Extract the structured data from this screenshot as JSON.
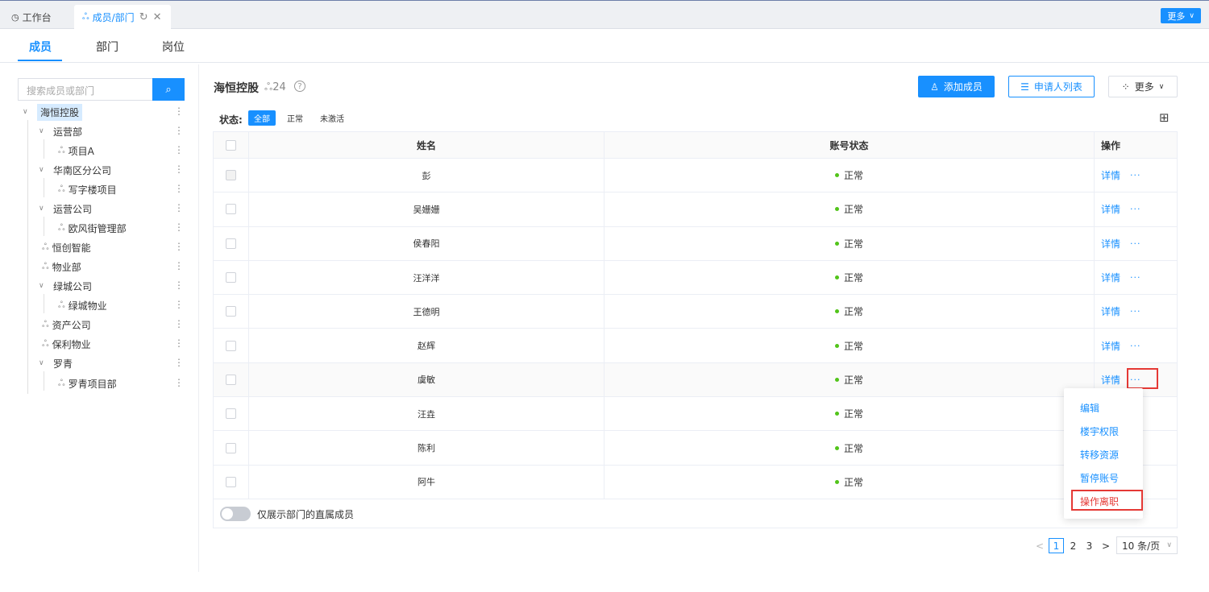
{
  "topbar": {
    "tabs": [
      {
        "label": "工作台",
        "icon": "dashboard-icon"
      },
      {
        "label": "成员/部门",
        "icon": "org-chart-icon"
      }
    ],
    "more_label": "更多"
  },
  "subnav": {
    "items": [
      "成员",
      "部门",
      "岗位"
    ],
    "active": "成员"
  },
  "sidebar": {
    "search_placeholder": "搜索成员或部门",
    "tree": [
      {
        "label": "海恒控股",
        "level": 0,
        "expandable": true,
        "selected": true
      },
      {
        "label": "运营部",
        "level": 1,
        "expandable": true
      },
      {
        "label": "项目A",
        "level": 2,
        "expandable": false
      },
      {
        "label": "华南区分公司",
        "level": 1,
        "expandable": true
      },
      {
        "label": "写字楼项目",
        "level": 2,
        "expandable": false
      },
      {
        "label": "运营公司",
        "level": 1,
        "expandable": true
      },
      {
        "label": "欧风街管理部",
        "level": 2,
        "expandable": false
      },
      {
        "label": "恒创智能",
        "level": 1,
        "expandable": false
      },
      {
        "label": "物业部",
        "level": 1,
        "expandable": false
      },
      {
        "label": "绿城公司",
        "level": 1,
        "expandable": true
      },
      {
        "label": "绿城物业",
        "level": 2,
        "expandable": false
      },
      {
        "label": "资产公司",
        "level": 1,
        "expandable": false
      },
      {
        "label": "保利物业",
        "level": 1,
        "expandable": false
      },
      {
        "label": "罗青",
        "level": 1,
        "expandable": true
      },
      {
        "label": "罗青项目部",
        "level": 2,
        "expandable": false
      }
    ]
  },
  "main": {
    "title": "海恒控股",
    "member_count": "24",
    "buttons": {
      "add": "添加成员",
      "applicants": "申请人列表",
      "more": "更多"
    },
    "status_label": "状态:",
    "filters": [
      "全部",
      "正常",
      "未激活"
    ],
    "columns": {
      "name": "姓名",
      "status": "账号状态",
      "ops": "操作"
    },
    "rows": [
      {
        "name": "彭",
        "status": "正常"
      },
      {
        "name": "吴姗姗",
        "status": "正常"
      },
      {
        "name": "侯春阳",
        "status": "正常"
      },
      {
        "name": "汪洋洋",
        "status": "正常"
      },
      {
        "name": "王德明",
        "status": "正常"
      },
      {
        "name": "赵辉",
        "status": "正常"
      },
      {
        "name": "虞敏",
        "status": "正常"
      },
      {
        "name": "汪垚",
        "status": "正常"
      },
      {
        "name": "陈利",
        "status": "正常"
      },
      {
        "name": "阿牛",
        "status": "正常"
      }
    ],
    "detail_label": "详情",
    "more_dots": "···",
    "toggle_label": "仅展示部门的直属成员"
  },
  "menu": {
    "items": [
      "编辑",
      "楼宇权限",
      "转移资源",
      "暂停账号",
      "操作离职"
    ]
  },
  "pagination": {
    "prev": "<",
    "pages": [
      "1",
      "2",
      "3"
    ],
    "next": ">",
    "page_size": "10 条/页"
  },
  "colors": {
    "accent": "#1890ff",
    "danger": "#e53935",
    "success": "#52c41a"
  }
}
